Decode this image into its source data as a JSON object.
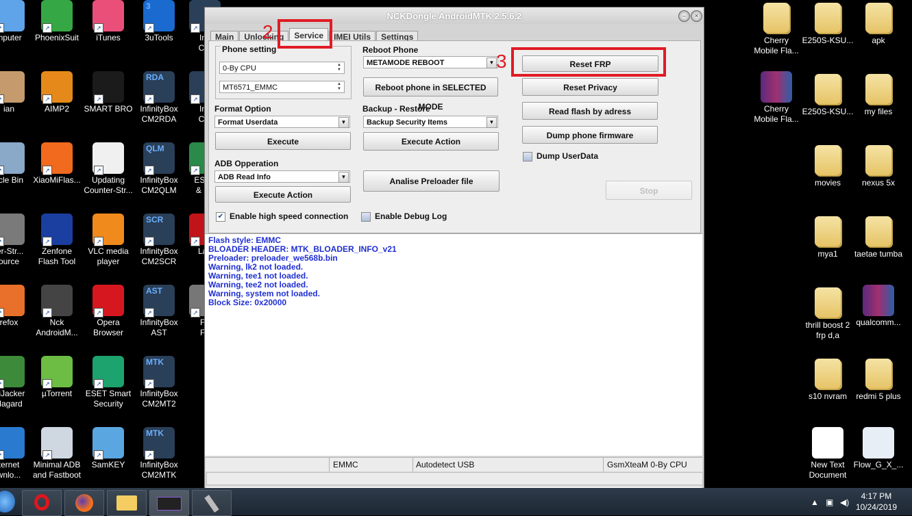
{
  "desktop": {
    "col1": [
      "mputer",
      "ian",
      "ycle Bin",
      "ter-Str...\nource",
      "refox",
      "HiJacker\nHagard",
      "ternet\nwnlo..."
    ],
    "col2": [
      "PhoenixSuit",
      "AIMP2",
      "XiaoMiFlas...",
      "Zenfone\nFlash Tool",
      "Nck\nAndroidM...",
      "µTorrent",
      "Minimal ADB\nand Fastboot"
    ],
    "col3": [
      "iTunes",
      "SMART BRO",
      "Updating\nCounter-Str...",
      "VLC media\nplayer",
      "Opera\nBrowser",
      "ESET Smart\nSecurity",
      "SamKEY"
    ],
    "col4": [
      "3uTools",
      "InfinityBox\nCM2RDA",
      "InfinityBox\nCM2QLM",
      "InfinityBox\nCM2SCR",
      "InfinityBox\nAST",
      "InfinityBox\nCM2MT2",
      "InfinityBox\nCM2MTK"
    ],
    "col4_badges": [
      "3",
      "RDA",
      "QLM",
      "SCR",
      "AST",
      "MTK",
      "MTK"
    ],
    "col5": [
      "Infi\nCM",
      "Infi\nCM",
      "ESET\n& Pa",
      "Lau",
      "Fo\nFa"
    ],
    "right1": [
      "Cherry\nMobile Fla...",
      "Cherry\nMobile Fla..."
    ],
    "right2": [
      "E250S-KSU...",
      "E250S-KSU...",
      "movies",
      "mya1",
      "thrill boost 2\nfrp d,a",
      "s10 nvram",
      "New Text\nDocument"
    ],
    "right3": [
      "apk",
      "my files",
      "nexus 5x",
      "taetae tumba",
      "qualcomm...",
      "redmi 5 plus",
      "Flow_G_X_..."
    ]
  },
  "window": {
    "title": "NCKDongle AndroidMTK 2.5.6.2",
    "tabs": [
      "Main",
      "Unlocking",
      "Service",
      "IMEI Utils",
      "Settings"
    ],
    "active_tab": "Service",
    "phone_setting": {
      "label": "Phone setting",
      "cpu_value": "0-By CPU",
      "chip_value": "MT6571_EMMC"
    },
    "reboot": {
      "label": "Reboot Phone",
      "value": "METAMODE REBOOT",
      "button": "Reboot phone in SELECTED MODE"
    },
    "format": {
      "label": "Format Option",
      "value": "Format Userdata",
      "button": "Execute"
    },
    "backup": {
      "label": "Backup - Restore",
      "value": "Backup Security Items",
      "button": "Execute Action"
    },
    "adb": {
      "label": "ADB Opperation",
      "value": "ADB Read Info",
      "button": "Execute Action"
    },
    "analise_button": "Analise Preloader file",
    "right_buttons": [
      "Reset FRP",
      "Reset Privacy",
      "Read flash by adress",
      "Dump phone firmware"
    ],
    "dump_userdata": "Dump UserData",
    "stop_button": "Stop",
    "high_speed": "Enable high speed connection",
    "debug_log": "Enable Debug Log",
    "log_lines": [
      "Flash style: EMMC",
      "BLOADER HEADER:  MTK_BLOADER_INFO_v21",
      "Preloader:  preloader_we568b.bin",
      "Warning, lk2 not loaded.",
      "Warning, tee1 not loaded.",
      "Warning, tee2 not loaded.",
      "Warning, system not loaded.",
      "Block Size: 0x20000"
    ],
    "status": {
      "storage": "EMMC",
      "usb": "Autodetect USB",
      "cpu": "GsmXteaM 0-By CPU"
    }
  },
  "annotations": {
    "step2": "2",
    "step3": "3"
  },
  "taskbar": {
    "time": "4:17 PM",
    "date": "10/24/2019"
  }
}
